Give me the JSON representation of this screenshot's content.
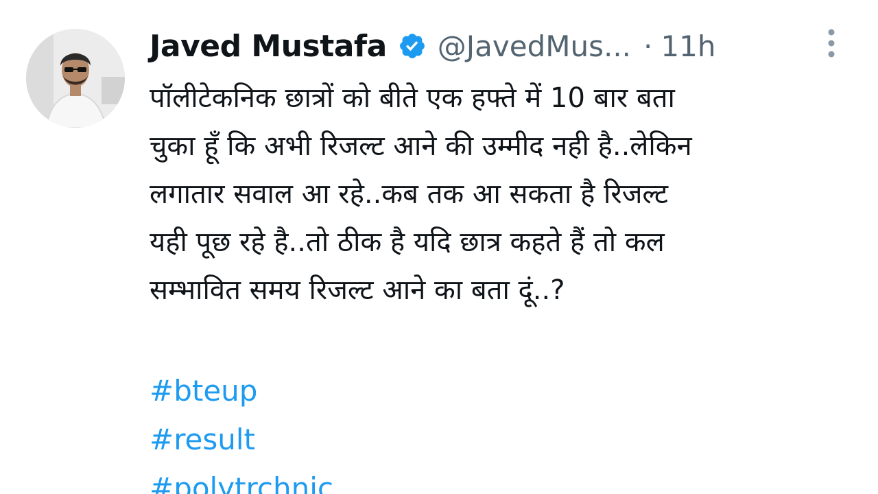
{
  "tweet": {
    "author": {
      "name": "Javed Mustafa",
      "handle": "@JavedMus...",
      "separator": "·",
      "time": "11h",
      "verified_icon": "verified-badge-icon",
      "avatar_icon": "profile-avatar"
    },
    "more_icon": "more-options-icon",
    "text_lines": [
      "पॉलीटेकनिक छात्रों को बीते एक हफ्ते में 10 बार बता",
      "चुका हूँ कि अभी रिजल्ट आने की उम्मीद नही है..लेकिन",
      "लगातार सवाल आ रहे..कब तक आ सकता है रिजल्ट",
      "यही पूछ रहे है..तो ठीक है यदि छात्र कहते हैं तो कल",
      "सम्भावित समय रिजल्ट आने का बता दूं..?"
    ],
    "hashtags": [
      "#bteup",
      "#result",
      "#polytrchnic"
    ]
  },
  "colors": {
    "text": "#0f1419",
    "secondary": "#536471",
    "link": "#1d9bf0",
    "verified": "#1d9bf0"
  }
}
